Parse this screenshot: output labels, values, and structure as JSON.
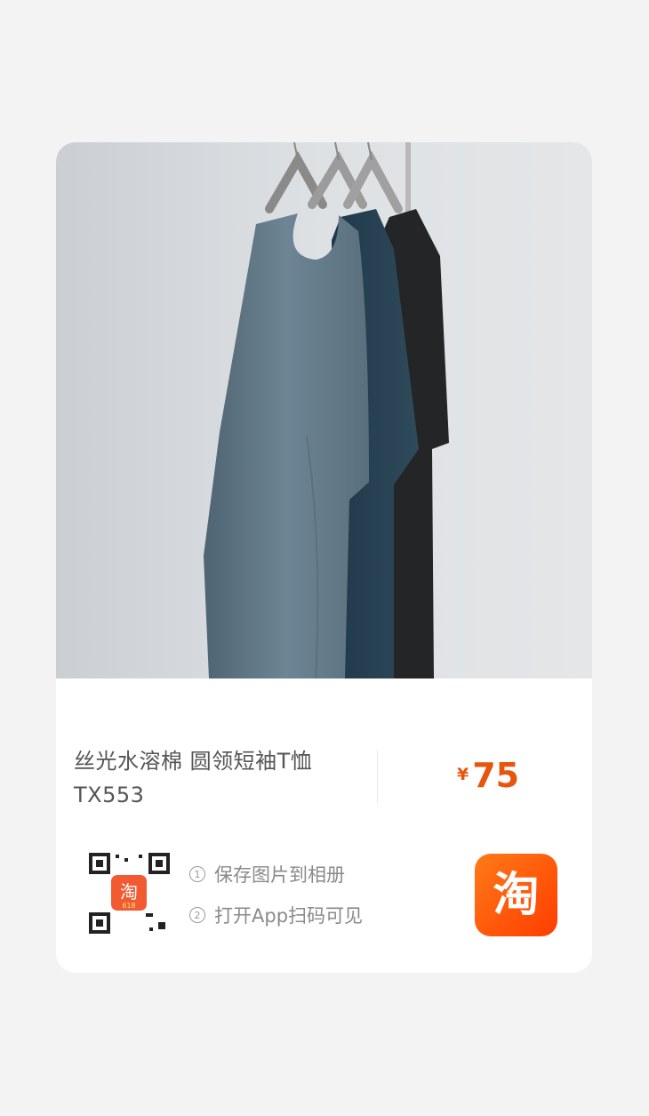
{
  "product": {
    "title": "丝光水溶棉 圆领短袖T恤 TX553",
    "currency": "¥",
    "price": "75"
  },
  "share": {
    "steps": [
      {
        "num": "1",
        "text": "保存图片到相册"
      },
      {
        "num": "2",
        "text": "打开App扫码可见"
      }
    ],
    "qr_badge_text": "淘",
    "qr_badge_sub": "618",
    "app_icon_text": "淘"
  },
  "colors": {
    "price": "#e8560e",
    "brand": "#ff5a0a"
  },
  "icons": [
    "qr-code-icon",
    "taobao-app-icon"
  ]
}
